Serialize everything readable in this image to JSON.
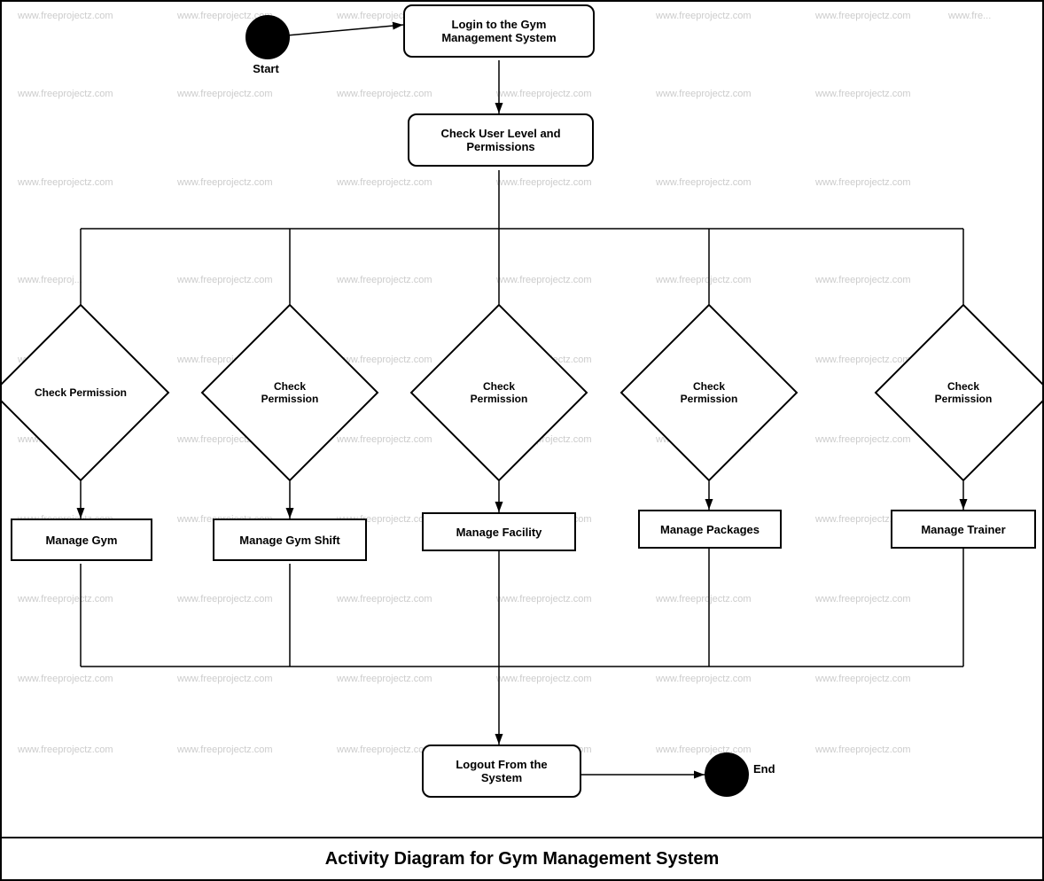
{
  "diagram": {
    "title": "Activity Diagram for Gym Management System",
    "watermark_text": "www.freeprojectz.com",
    "nodes": {
      "start_label": "Start",
      "login_box": "Login to the Gym Management System",
      "check_user_box": "Check User Level and Permissions",
      "check_perm1": "Check\nPermission",
      "check_perm2": "Check\nPermission",
      "check_perm3": "Check\nPermission",
      "check_perm4": "Check\nPermission",
      "check_perm5": "Check\nPermission",
      "manage_gym": "Manage Gym",
      "manage_gym_shift": "Manage Gym Shift",
      "manage_facility": "Manage Facility",
      "manage_packages": "Manage Packages",
      "manage_trainer": "Manage Trainer",
      "logout_box": "Logout From the System",
      "end_label": "End"
    }
  }
}
